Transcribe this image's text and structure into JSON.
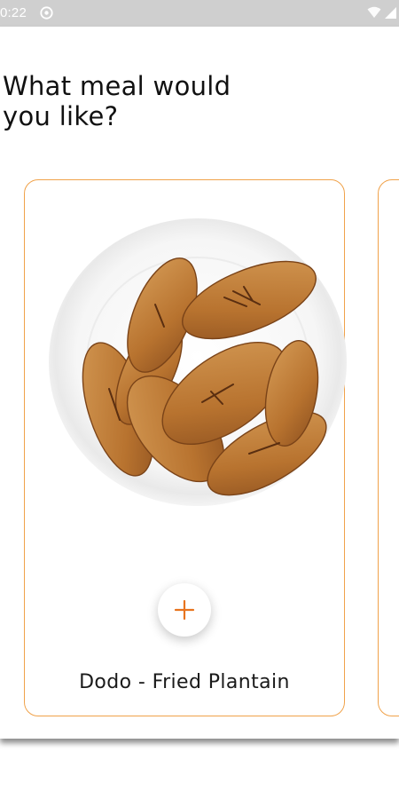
{
  "status_bar": {
    "time": "0:22",
    "app_icon": "circle-app-icon",
    "wifi_icon": "wifi-icon",
    "signal_icon": "signal-icon"
  },
  "page": {
    "title": "What meal would\nyou like?"
  },
  "cards": [
    {
      "name": "Dodo - Fried Plantain",
      "image": "fried-plantain-plate-image",
      "add_icon": "plus-icon"
    }
  ],
  "colors": {
    "accent": "#f0a24a",
    "plus": "#e8741e",
    "status_bar": "#cfcfcf",
    "text": "#111111"
  }
}
